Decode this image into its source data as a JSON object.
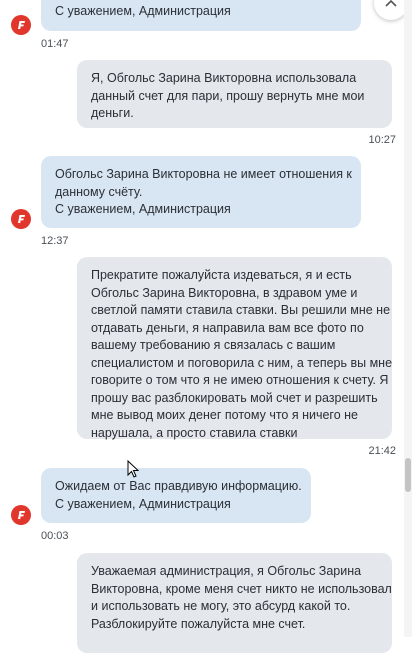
{
  "messages": [
    {
      "sender": "admin",
      "lines": [
        "С уважением, Администрация"
      ],
      "time": "01:47"
    },
    {
      "sender": "user",
      "lines": [
        "Я, Обгольс Зарина Викторовна использовала",
        "данный счет для пари, прошу вернуть мне мои",
        "деньги."
      ],
      "time": "10:27"
    },
    {
      "sender": "admin",
      "lines": [
        "Обгольс Зарина Викторовна не имеет отношения к",
        "данному счёту.",
        "С уважением, Администрация"
      ],
      "time": "12:37"
    },
    {
      "sender": "user",
      "lines": [
        "Прекратите пожалуйста издеваться, я и есть",
        "Обгольс Зарина Викторовна, в здравом уме и",
        "светлой памяти ставила ставки. Вы решили мне не",
        "отдавать деньги, я направила вам все фото по",
        "вашему требованию я связалась с вашим",
        "специалистом и поговорила с ним, а теперь вы мне",
        "говорите о том что я не имею отношения к счету. Я",
        "прошу вас разблокировать мой счет и разрешить",
        "мне вывод моих денег потому что я ничего не",
        "нарушала, а просто ставила ставки"
      ],
      "time": "21:42"
    },
    {
      "sender": "admin",
      "lines": [
        "Ожидаем от Вас правдивую информацию.",
        "С уважением, Администрация"
      ],
      "time": "00:03"
    },
    {
      "sender": "user",
      "lines": [
        "Уважаемая администрация, я Обгольс Зарина",
        "Викторовна, кроме меня счет никто не использовал",
        "и использовать не могу, это абсурд какой то.",
        "Разблокируйте пожалуйста мне счет."
      ],
      "time": ""
    }
  ],
  "icons": {
    "avatar": "brand-logo-icon",
    "scroll_top": "chevron-up-icon",
    "cursor": "mouse-pointer-icon"
  },
  "colors": {
    "admin_bubble": "#d8e6f3",
    "user_bubble": "#e4e7ec",
    "avatar": "#e0362b"
  }
}
